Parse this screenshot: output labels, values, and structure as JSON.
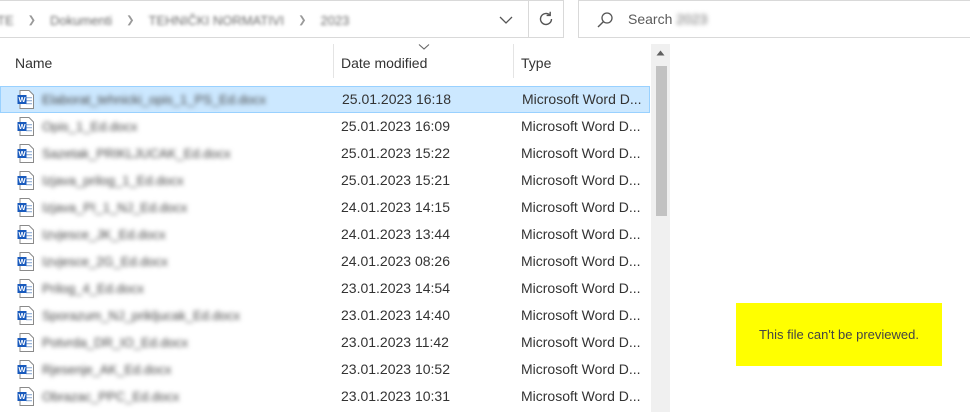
{
  "address_bar": {
    "breadcrumbs": [
      "TE",
      "Dokumenti",
      "TEHNIČKI NORMATIVI",
      "2023"
    ]
  },
  "search": {
    "prefix": "Search",
    "target": "2023"
  },
  "columns": {
    "name": "Name",
    "date_modified": "Date modified",
    "type": "Type"
  },
  "files": [
    {
      "name": "Elaborat_tehnicki_opis_1_PS_Ed.docx",
      "date": "25.01.2023 16:18",
      "type": "Microsoft Word D...",
      "selected": true
    },
    {
      "name": "Opis_1_Ed.docx",
      "date": "25.01.2023 16:09",
      "type": "Microsoft Word D...",
      "selected": false
    },
    {
      "name": "Sazetak_PRIKLJUCAK_Ed.docx",
      "date": "25.01.2023 15:22",
      "type": "Microsoft Word D...",
      "selected": false
    },
    {
      "name": "Izjava_prilog_1_Ed.docx",
      "date": "25.01.2023 15:21",
      "type": "Microsoft Word D...",
      "selected": false
    },
    {
      "name": "Izjava_PI_1_NJ_Ed.docx",
      "date": "24.01.2023 14:15",
      "type": "Microsoft Word D...",
      "selected": false
    },
    {
      "name": "Izvjesce_JK_Ed.docx",
      "date": "24.01.2023 13:44",
      "type": "Microsoft Word D...",
      "selected": false
    },
    {
      "name": "Izvjesce_2G_Ed.docx",
      "date": "24.01.2023 08:26",
      "type": "Microsoft Word D...",
      "selected": false
    },
    {
      "name": "Prilog_4_Ed.docx",
      "date": "23.01.2023 14:54",
      "type": "Microsoft Word D...",
      "selected": false
    },
    {
      "name": "Sporazum_NJ_prikljucak_Ed.docx",
      "date": "23.01.2023 14:40",
      "type": "Microsoft Word D...",
      "selected": false
    },
    {
      "name": "Potvrda_DR_IO_Ed.docx",
      "date": "23.01.2023 11:42",
      "type": "Microsoft Word D...",
      "selected": false
    },
    {
      "name": "Rjesenje_AK_Ed.docx",
      "date": "23.01.2023 10:52",
      "type": "Microsoft Word D...",
      "selected": false
    },
    {
      "name": "Obrazac_PPC_Ed.docx",
      "date": "23.01.2023 10:31",
      "type": "Microsoft Word D...",
      "selected": false
    }
  ],
  "icons": {
    "file": "word-document-icon",
    "address_dropdown": "chevron-down-icon",
    "refresh": "refresh-icon",
    "search": "search-icon",
    "sort": "sort-chevron-icon",
    "scroll_up": "scroll-up-arrow-icon"
  },
  "preview": {
    "message": "This file can't be previewed."
  },
  "colors": {
    "selection_bg": "#cce8ff",
    "selection_border": "#99d1ff",
    "word_blue": "#185abd",
    "highlight_yellow": "#ffff00",
    "scroll_thumb": "#c2c2c2"
  }
}
